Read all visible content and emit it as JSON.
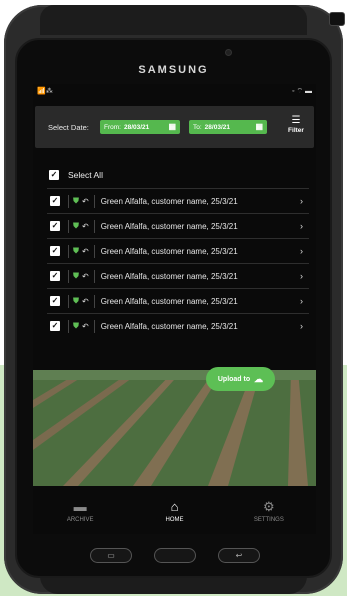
{
  "device": {
    "brand": "SAMSUNG"
  },
  "status_bar": {
    "left": "📶⁂",
    "right": "◦ ⌔ ▬"
  },
  "filter": {
    "select_date_label": "Select Date:",
    "from_prefix": "From:",
    "from_value": "28/03/21",
    "to_prefix": "To:",
    "to_value": "28/03/21",
    "filter_label": "Filter"
  },
  "list": {
    "select_all_label": "Select All",
    "items": [
      {
        "label": "Green Alfalfa, customer name, 25/3/21"
      },
      {
        "label": "Green Alfalfa, customer name, 25/3/21"
      },
      {
        "label": "Green Alfalfa, customer name, 25/3/21"
      },
      {
        "label": "Green Alfalfa, customer name, 25/3/21"
      },
      {
        "label": "Green Alfalfa, customer name, 25/3/21"
      },
      {
        "label": "Green Alfalfa, customer name, 25/3/21"
      }
    ]
  },
  "upload": {
    "label": "Upload to"
  },
  "nav": {
    "archive": "ARCHIVE",
    "home": "HOME",
    "settings": "SETTINGS"
  },
  "colors": {
    "accent": "#55b84e",
    "background": "#0a0a0a",
    "panel": "#2a2a2a"
  }
}
